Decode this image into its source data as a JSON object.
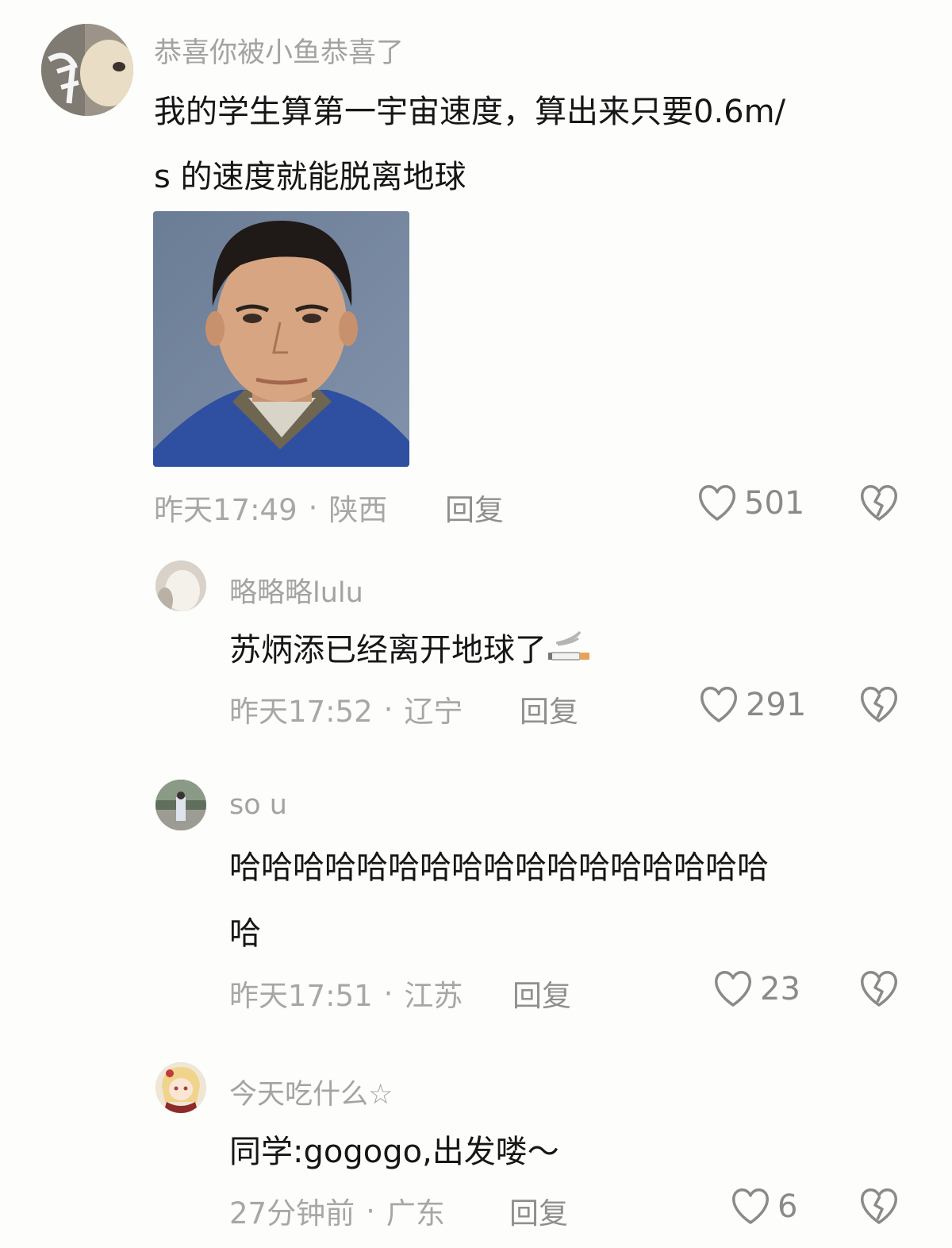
{
  "comments": [
    {
      "username": "恭喜你被小鱼恭喜了",
      "text_lines": [
        "我的学生算第一宇宙速度，算出来只要0.6m/",
        "s 的速度就能脱离地球"
      ],
      "time": "昨天17:49",
      "location": "陕西",
      "reply_label": "回复",
      "likes": "501"
    },
    {
      "username": "略略略lulu",
      "text_lines": [
        "苏炳添已经离开地球了"
      ],
      "emoji": "cigarette-emoji",
      "time": "昨天17:52",
      "location": "辽宁",
      "reply_label": "回复",
      "likes": "291"
    },
    {
      "username": "so u",
      "text_lines": [
        "哈哈哈哈哈哈哈哈哈哈哈哈哈哈哈哈哈",
        "哈"
      ],
      "time": "昨天17:51",
      "location": "江苏",
      "reply_label": "回复",
      "likes": "23"
    },
    {
      "username": "今天吃什么☆",
      "text_lines": [
        "同学:gogogo,出发喽～"
      ],
      "time": "27分钟前",
      "location": "广东",
      "reply_label": "回复",
      "likes": "6"
    }
  ],
  "separator": "·",
  "colors": {
    "background": "#fdfdfb",
    "text": "#161616",
    "muted": "#a7a7a7",
    "icon": "#8a8a8a"
  },
  "icons": {
    "like": "heart-outline-icon",
    "dislike": "broken-heart-icon"
  }
}
